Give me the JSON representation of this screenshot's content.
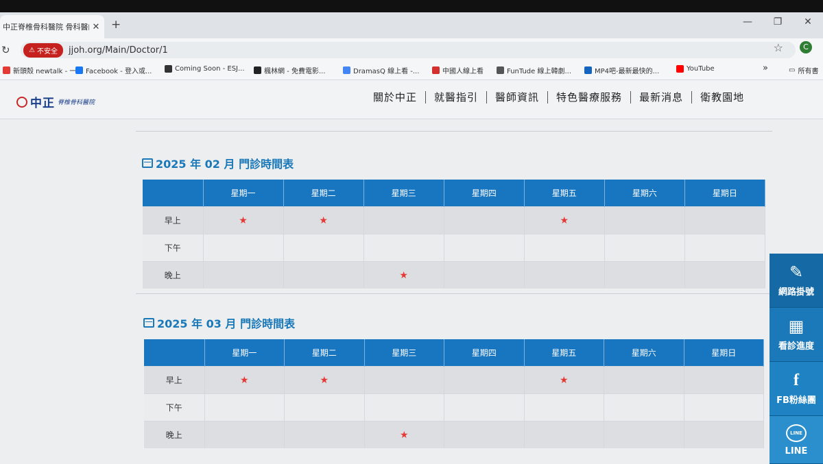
{
  "browser": {
    "tab_title": "中正脊椎骨科醫院 骨科醫師 吳",
    "tab_close": "✕",
    "new_tab": "+",
    "win_min": "—",
    "win_max": "❐",
    "win_close": "✕",
    "reload": "↻",
    "insecure_label": "不安全",
    "url": "jjoh.org/Main/Doctor/1",
    "bookmark_star": "☆",
    "avatar_letter": "C",
    "bookmarks": [
      {
        "label": "新頭殼 newtalk - 一...",
        "color": "#e53935"
      },
      {
        "label": "Facebook - 登入或...",
        "color": "#1877f2"
      },
      {
        "label": "Coming Soon - ESJ...",
        "color": "#333333"
      },
      {
        "label": "楓林網 - 免費電影...",
        "color": "#222222"
      },
      {
        "label": "DramasQ 線上看 -...",
        "color": "#4285f4"
      },
      {
        "label": "中國人線上看",
        "color": "#d32f2f"
      },
      {
        "label": "FunTude 線上韓劇...",
        "color": "#555555"
      },
      {
        "label": "MP4吧-最新最快的...",
        "color": "#1565c0"
      },
      {
        "label": "YouTube",
        "color": "#ff0000"
      }
    ],
    "more_bookmarks": "»",
    "all_bookmarks": "所有書"
  },
  "site": {
    "logo_text": "中正",
    "logo_sub": "脊椎骨科醫院",
    "nav": [
      "關於中正",
      "就醫指引",
      "醫師資訊",
      "特色醫療服務",
      "最新消息",
      "衛教園地"
    ]
  },
  "schedules": [
    {
      "title": "2025 年 02 月 門診時間表",
      "days": [
        "星期一",
        "星期二",
        "星期三",
        "星期四",
        "星期五",
        "星期六",
        "星期日"
      ],
      "rows": [
        {
          "label": "早上",
          "marks": [
            true,
            true,
            false,
            false,
            true,
            false,
            false
          ]
        },
        {
          "label": "下午",
          "marks": [
            false,
            false,
            false,
            false,
            false,
            false,
            false
          ]
        },
        {
          "label": "晚上",
          "marks": [
            false,
            false,
            true,
            false,
            false,
            false,
            false
          ]
        }
      ]
    },
    {
      "title": "2025 年 03 月 門診時間表",
      "days": [
        "星期一",
        "星期二",
        "星期三",
        "星期四",
        "星期五",
        "星期六",
        "星期日"
      ],
      "rows": [
        {
          "label": "早上",
          "marks": [
            true,
            true,
            false,
            false,
            true,
            false,
            false
          ]
        },
        {
          "label": "下午",
          "marks": [
            false,
            false,
            false,
            false,
            false,
            false,
            false
          ]
        },
        {
          "label": "晚上",
          "marks": [
            false,
            false,
            true,
            false,
            false,
            false,
            false
          ]
        }
      ]
    }
  ],
  "mark_symbol": "★",
  "side_panel": [
    {
      "label": "網路掛號",
      "icon": "✎",
      "icon_name": "clipboard-icon"
    },
    {
      "label": "看診進度",
      "icon": "▦",
      "icon_name": "calendar-clock-icon"
    },
    {
      "label": "FB粉絲團",
      "icon": "f",
      "icon_name": "facebook-icon"
    },
    {
      "label": "LINE",
      "icon": "LINE",
      "icon_name": "line-icon"
    }
  ]
}
